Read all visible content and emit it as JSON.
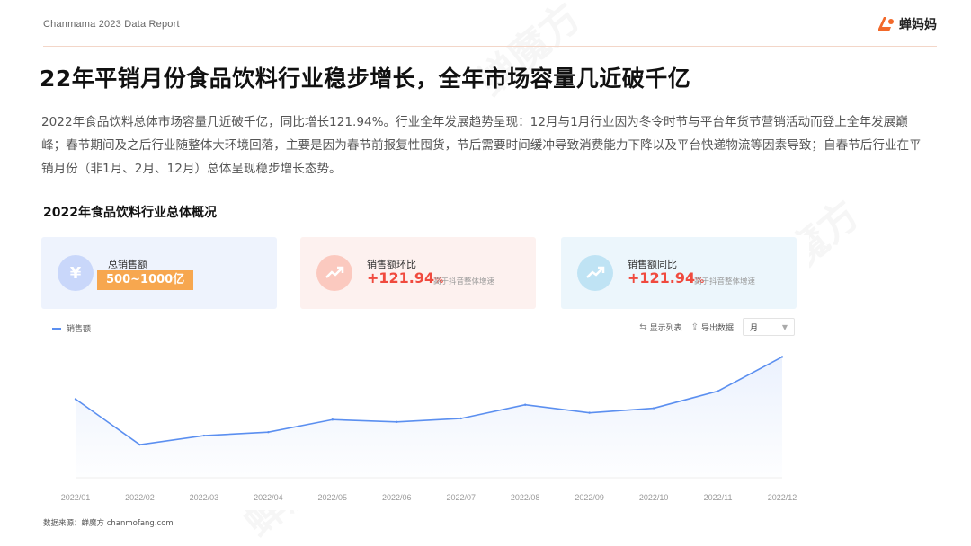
{
  "header": {
    "report_label": "Chanmama 2023 Data Report",
    "brand_name": "蝉妈妈",
    "brand_color": "#f2692a"
  },
  "page_title": "22年平销月份食品饮料行业稳步增长，全年市场容量几近破千亿",
  "summary": "2022年食品饮料总体市场容量几近破千亿，同比增长121.94%。行业全年发展趋势呈现：12月与1月行业因为冬令时节与平台年货节营销活动而登上全年发展巅峰；春节期间及之后行业随整体大环境回落，主要是因为春节前报复性囤货，节后需要时间缓冲导致消费能力下降以及平台快递物流等因素导致；自春节后行业在平销月份（非1月、2月、12月）总体呈现稳步增长态势。",
  "panel": {
    "title": "2022年食品饮料行业总体概况",
    "cards": [
      {
        "label": "总销售额",
        "value": "500~1000亿",
        "icon": "yuan-icon",
        "accent": "#f7a74f"
      },
      {
        "label": "销售额环比",
        "value": "+121.94",
        "unit": "%",
        "note": "高于抖音整体增速",
        "icon": "trend-up-icon",
        "accent": "#f04a3e"
      },
      {
        "label": "销售额同比",
        "value": "+121.94",
        "unit": "%",
        "note": "高于抖音整体增速",
        "icon": "trend-up-icon",
        "accent": "#f04a3e"
      }
    ],
    "legend_label": "销售额",
    "toolbar": {
      "show_list": "显示列表",
      "export": "导出数据",
      "period": "月"
    }
  },
  "chart_data": {
    "type": "line",
    "x": [
      "2022/01",
      "2022/02",
      "2022/03",
      "2022/04",
      "2022/05",
      "2022/06",
      "2022/07",
      "2022/08",
      "2022/09",
      "2022/10",
      "2022/11",
      "2022/12"
    ],
    "series": [
      {
        "name": "销售额",
        "values": [
          69,
          29,
          37,
          40,
          51,
          49,
          52,
          64,
          57,
          61,
          76,
          106
        ],
        "color": "#5b8ff0"
      }
    ],
    "ylim": [
      0,
      115
    ],
    "grid": false,
    "legend": "top-left"
  },
  "source": "数据来源：蝉魔方 chanmofang.com",
  "watermark_text": "蝉魔方"
}
